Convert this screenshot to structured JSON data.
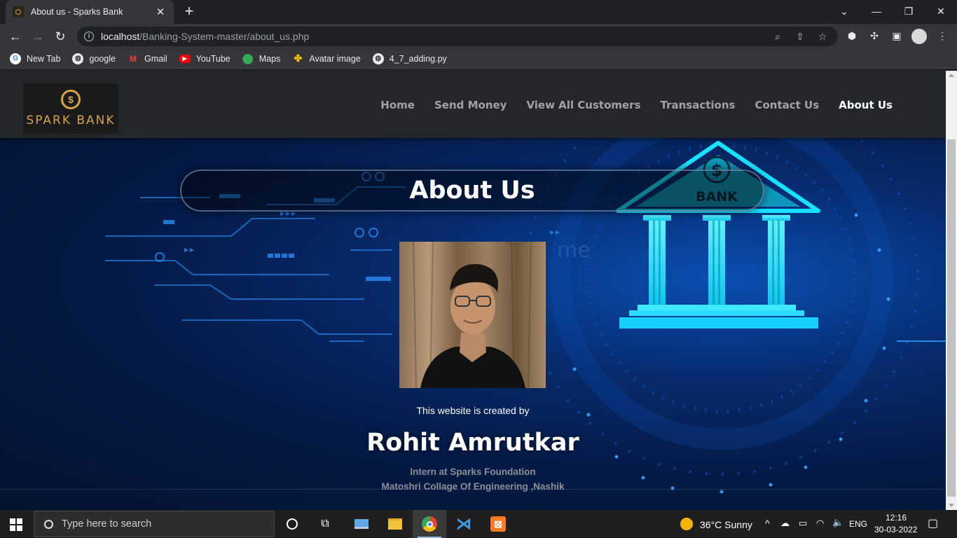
{
  "browser": {
    "tab_title": "About us - Sparks Bank",
    "url_host": "localhost",
    "url_path": "/Banking-System-master/about_us.php",
    "bookmarks": [
      {
        "label": "New Tab",
        "icon": "google-icon",
        "color": "#4285f4"
      },
      {
        "label": "google",
        "icon": "globe-icon",
        "color": "#5f6368"
      },
      {
        "label": "Gmail",
        "icon": "gmail-icon",
        "color": "#ea4335"
      },
      {
        "label": "YouTube",
        "icon": "youtube-icon",
        "color": "#ff0000"
      },
      {
        "label": "Maps",
        "icon": "maps-icon",
        "color": "#34a853"
      },
      {
        "label": "Avatar image",
        "icon": "pinwheel-icon",
        "color": "#fbbc05"
      },
      {
        "label": "4_7_adding.py",
        "icon": "globe-icon",
        "color": "#5f6368"
      }
    ]
  },
  "site": {
    "logo_text": "SPARK BANK",
    "logo_symbol": "$",
    "nav": [
      {
        "label": "Home",
        "active": false
      },
      {
        "label": "Send Money",
        "active": false
      },
      {
        "label": "View All Customers",
        "active": false
      },
      {
        "label": "Transactions",
        "active": false
      },
      {
        "label": "Contact Us",
        "active": false
      },
      {
        "label": "About Us",
        "active": true
      }
    ],
    "page_title": "About Us",
    "bank_sign": "BANK",
    "bank_symbol": "$",
    "bg_watermark": "me",
    "created_by": "This website is created by",
    "author_name": "Rohit Amrutkar",
    "author_role": "Intern at Sparks Foundation",
    "author_college": "Matoshri Collage Of Engineering ,Nashik"
  },
  "taskbar": {
    "search_placeholder": "Type here to search",
    "weather": "36°C  Sunny",
    "language": "ENG",
    "time": "12:16",
    "date": "30-03-2022"
  },
  "colors": {
    "accent_gold": "#d4a34a",
    "bank_cyan": "#18e6ff",
    "nav_bg": "#23262b",
    "page_bg": "#061a3a"
  }
}
